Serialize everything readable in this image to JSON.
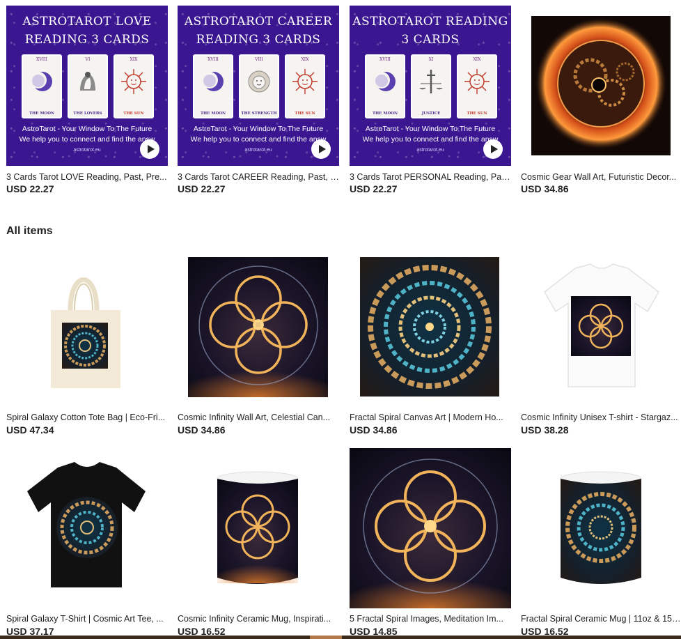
{
  "top_row": [
    {
      "title": "3 Cards Tarot LOVE Reading, Past, Pre...",
      "price": "USD 22.27",
      "image": {
        "heading": "ASTROTAROT LOVE READING 3 CARDS",
        "cards": [
          {
            "num": "XVIII",
            "name": "THE MOON",
            "symbol": "moon-icon"
          },
          {
            "num": "VI",
            "name": "THE LOVERS",
            "symbol": "lovers-icon"
          },
          {
            "num": "XIX",
            "name": "THE SUN",
            "symbol": "sun-icon"
          }
        ],
        "line1": "AstroTarot - Your Window To The Future",
        "line2": "We help you to connect and find the answ",
        "site": "astrotarot.eu"
      }
    },
    {
      "title": "3 Cards Tarot CAREER Reading, Past, P...",
      "price": "USD 22.27",
      "image": {
        "heading": "ASTROTAROT CAREER READING 3 CARDS",
        "cards": [
          {
            "num": "XVIII",
            "name": "THE MOON",
            "symbol": "moon-icon"
          },
          {
            "num": "VIII",
            "name": "THE STRENGTH",
            "symbol": "lion-icon"
          },
          {
            "num": "XIX",
            "name": "THE SUN",
            "symbol": "sun-icon"
          }
        ],
        "line1": "AstroTarot - Your Window To The Future",
        "line2": "We help you to connect and find the answ",
        "site": "astrotarot.eu"
      }
    },
    {
      "title": "3 Cards Tarot PERSONAL Reading, Pas...",
      "price": "USD 22.27",
      "image": {
        "heading": "ASTROTAROT READING 3 CARDS",
        "cards": [
          {
            "num": "XVIII",
            "name": "THE MOON",
            "symbol": "moon-icon"
          },
          {
            "num": "XI",
            "name": "JUSTICE",
            "symbol": "justice-icon"
          },
          {
            "num": "XIX",
            "name": "THE SUN",
            "symbol": "sun-icon"
          }
        ],
        "line1": "AstroTarot - Your Window To The Future",
        "line2": "We help you to connect and find the answ",
        "site": "astrotarot.eu"
      }
    },
    {
      "title": "Cosmic Gear Wall Art, Futuristic Decor...",
      "price": "USD 34.86"
    }
  ],
  "section_title": "All items",
  "grid_row1": [
    {
      "title": "Spiral Galaxy Cotton Tote Bag | Eco-Fri...",
      "price": "USD 47.34"
    },
    {
      "title": "Cosmic Infinity Wall Art, Celestial Can...",
      "price": "USD 34.86"
    },
    {
      "title": "Fractal Spiral Canvas Art | Modern Ho...",
      "price": "USD 34.86"
    },
    {
      "title": "Cosmic Infinity Unisex T-shirt - Stargaz...",
      "price": "USD 38.28"
    }
  ],
  "grid_row2": [
    {
      "title": "Spiral Galaxy T-Shirt | Cosmic Art Tee, ...",
      "price": "USD 37.17"
    },
    {
      "title": "Cosmic Infinity Ceramic Mug, Inspirati...",
      "price": "USD 16.52"
    },
    {
      "title": "5 Fractal Spiral Images, Meditation Im...",
      "price": "USD 14.85"
    },
    {
      "title": "Fractal Spiral Ceramic Mug | 11oz & 15o...",
      "price": "USD 16.52"
    }
  ],
  "colors": {
    "tarot_bg": "#3a1690",
    "text": "#222222",
    "cosmic_gold": "#f2b45a",
    "cosmic_blue": "#3fa9c9"
  }
}
